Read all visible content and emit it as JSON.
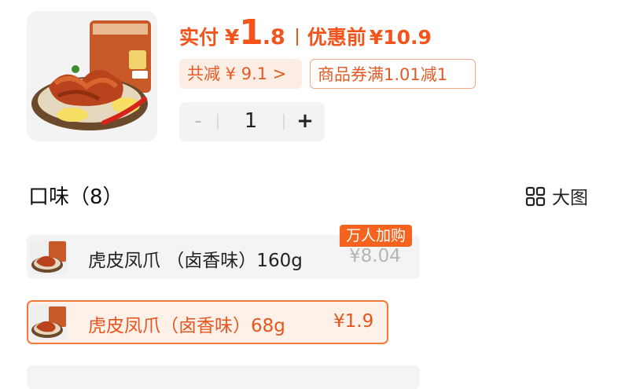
{
  "colors": {
    "accent": "#f2541b",
    "selected_border": "#f27a3a",
    "tag_bg": "#f5631f"
  },
  "product": {
    "image_icon": "braised-chicken-feet-image",
    "pay_label": "实付",
    "currency": "¥",
    "price_int": "1",
    "price_dec": ".8",
    "pre_label": "优惠前",
    "pre_price": "¥10.9",
    "reduce_chip": "共减 ¥ 9.1 >",
    "coupon_chip": "商品券满1.01减1"
  },
  "stepper": {
    "minus": "-",
    "quantity": "1",
    "plus": "+"
  },
  "flavor": {
    "title": "口味（8）",
    "view_toggle_icon": "grid-icon",
    "view_toggle_label": "大图",
    "options": [
      {
        "name": "虎皮凤爪 （卤香味）160g",
        "price": "¥8.04",
        "tag": "万人加购",
        "selected": false
      },
      {
        "name": "虎皮凤爪（卤香味）68g",
        "price": "¥1.9",
        "selected": true
      }
    ]
  }
}
